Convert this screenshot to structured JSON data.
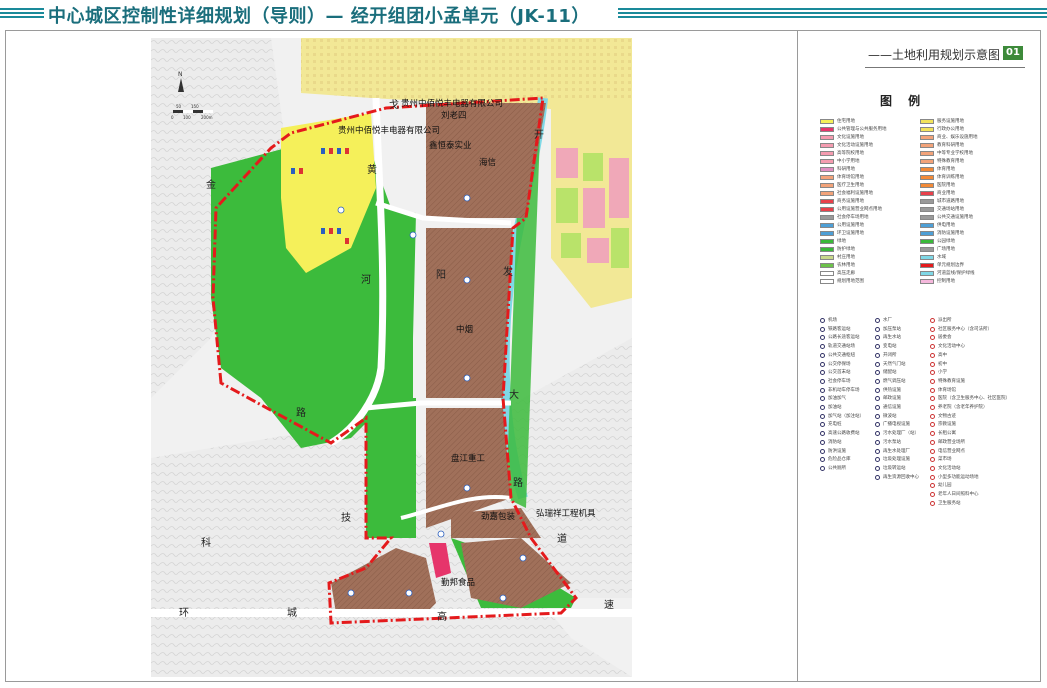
{
  "header": {
    "title": "中心城区控制性详细规划（导则）— 经开组团小孟单元（JK-11）"
  },
  "panel": {
    "map_title": "——土地利用规划示意图",
    "map_number": "01",
    "legend_title": "图 例"
  },
  "map": {
    "north_label": "N",
    "scale_labels": [
      "50",
      "150",
      "0",
      "100",
      "200m"
    ],
    "road_chars": [
      "金",
      "阳",
      "河",
      "路",
      "科",
      "技",
      "环",
      "城",
      "高",
      "速",
      "开",
      "发",
      "大",
      "道",
      "黄",
      "路",
      "戈"
    ],
    "labels": {
      "company_top": "贵州中佰悦丰电器有限公司",
      "person": "刘老四",
      "company_left": "贵州中佰悦丰电器有限公司",
      "xinhengtai": "鑫恒泰实业",
      "haixin": "海信",
      "zhongyan": "中烟",
      "panjiang": "盘江重工",
      "jinjia": "劲嘉包装",
      "hongrui": "弘瑞祥工程机具",
      "qinbang": "勤邦食品"
    }
  },
  "legend": {
    "colors": [
      {
        "label": "住宅用地",
        "color": "#f5f05a"
      },
      {
        "label": "公共管理与公共服务用地",
        "color": "#e6356b"
      },
      {
        "label": "文化设施用地",
        "color": "#f49cb0"
      },
      {
        "label": "文化活动设施用地",
        "color": "#f49cb0"
      },
      {
        "label": "高等院校用地",
        "color": "#f49cb0"
      },
      {
        "label": "中小学用地",
        "color": "#f49cb0"
      },
      {
        "label": "科研用地",
        "color": "#e08ec2"
      },
      {
        "label": "体育场馆用地",
        "color": "#f2a37a"
      },
      {
        "label": "医疗卫生用地",
        "color": "#f2a37a"
      },
      {
        "label": "社会福利设施用地",
        "color": "#f2a37a"
      },
      {
        "label": "商务设施用地",
        "color": "#e8404b"
      },
      {
        "label": "公用设施营业网点用地",
        "color": "#e8404b"
      },
      {
        "label": "社会停车场用地",
        "color": "#9a9a9a"
      },
      {
        "label": "公用设施用地",
        "color": "#4d9fd6"
      },
      {
        "label": "环卫设施用地",
        "color": "#4d9fd6"
      },
      {
        "label": "绿地",
        "color": "#3ab93a"
      },
      {
        "label": "防护绿地",
        "color": "#3ab93a"
      },
      {
        "label": "村庄用地",
        "color": "#c9d98c"
      },
      {
        "label": "农林用地",
        "color": "#6cc24a"
      },
      {
        "label": "高压走廊",
        "color": "#ffffff"
      },
      {
        "label": "规划用地范围",
        "color": "#ffffff"
      },
      {
        "label": "服务设施用地",
        "color": "#f2e35c"
      },
      {
        "label": "行政办公用地",
        "color": "#f2e35c"
      },
      {
        "label": "商业、娱乐设施用地",
        "color": "#f2a37a"
      },
      {
        "label": "教育科研用地",
        "color": "#f2a37a"
      },
      {
        "label": "中等专业学校用地",
        "color": "#f2a37a"
      },
      {
        "label": "特殊教育用地",
        "color": "#f2a37a"
      },
      {
        "label": "体育用地",
        "color": "#f28a38"
      },
      {
        "label": "体育训练用地",
        "color": "#f28a38"
      },
      {
        "label": "医院用地",
        "color": "#f28a38"
      },
      {
        "label": "商业用地",
        "color": "#e8404b"
      },
      {
        "label": "城市道路用地",
        "color": "#9a9a9a"
      },
      {
        "label": "交通场站用地",
        "color": "#9a9a9a"
      },
      {
        "label": "公共交通设施用地",
        "color": "#9a9a9a"
      },
      {
        "label": "供电用地",
        "color": "#4d9fd6"
      },
      {
        "label": "消防设施用地",
        "color": "#4d9fd6"
      },
      {
        "label": "公园绿地",
        "color": "#3ab93a"
      },
      {
        "label": "广场用地",
        "color": "#9a9a9a"
      },
      {
        "label": "水域",
        "color": "#7fd8e6"
      },
      {
        "label": "单元规划边界",
        "color": "#e41a1c"
      },
      {
        "label": "河道蓝线/保护绿线",
        "color": "#7fd8e6"
      },
      {
        "label": "控制用地",
        "color": "#f5b8dc"
      }
    ],
    "symbols_col1": [
      "机场",
      "铁路客运站",
      "公路长途客运站",
      "轨道交通站场",
      "公共交通枢纽",
      "公交停保场",
      "公交首末站",
      "社会停车场",
      "非机动车停车场",
      "加油加气",
      "加油站",
      "加气站（加注站）",
      "充电桩",
      "高速公路收费站",
      "消防站",
      "防洪设施",
      "危险品仓库",
      "公共厕所"
    ],
    "symbols_col2": [
      "水厂",
      "加压泵站",
      "再生水站",
      "变电站",
      "开闭所",
      "天然气门站",
      "储配站",
      "燃气调压站",
      "供热设施",
      "邮政设施",
      "通信设施",
      "微波站",
      "广播电视设施",
      "污水处理厂（站）",
      "污水泵站",
      "再生水处理厂",
      "垃圾处理设施",
      "垃圾转运站",
      "再生资源回收中心"
    ],
    "symbols_col3": [
      "派出所",
      "社区服务中心（含司法所）",
      "居委会",
      "文化活动中心",
      "高中",
      "初中",
      "小学",
      "特殊教育设施",
      "体育场馆",
      "医院（含卫生服务中心、社区医院）",
      "养老院（含老年养护院）",
      "文物古迹",
      "宗教设施",
      "长租公寓",
      "邮政营业场所",
      "电信营业网点",
      "菜市场",
      "文化活动站",
      "小型多功能运动场地",
      "幼儿园",
      "老年人日间照料中心",
      "卫生服务站"
    ]
  }
}
